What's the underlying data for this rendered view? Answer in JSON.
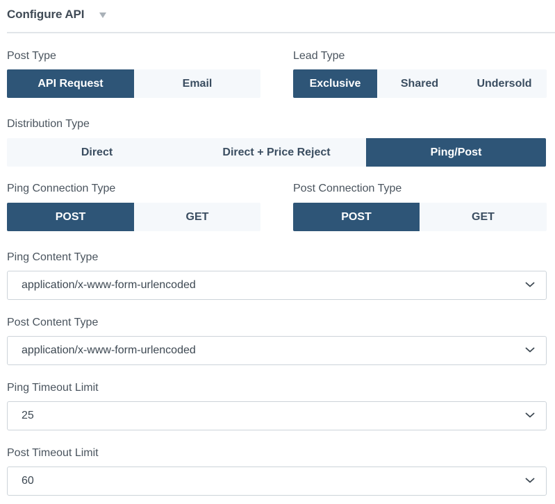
{
  "header": {
    "title": "Configure API"
  },
  "post_type": {
    "label": "Post Type",
    "options": [
      "API Request",
      "Email"
    ],
    "selected": "API Request"
  },
  "lead_type": {
    "label": "Lead Type",
    "options": [
      "Exclusive",
      "Shared",
      "Undersold"
    ],
    "selected": "Exclusive"
  },
  "distribution_type": {
    "label": "Distribution Type",
    "options": [
      "Direct",
      "Direct + Price Reject",
      "Ping/Post"
    ],
    "selected": "Ping/Post"
  },
  "ping_connection_type": {
    "label": "Ping Connection Type",
    "options": [
      "POST",
      "GET"
    ],
    "selected": "POST"
  },
  "post_connection_type": {
    "label": "Post Connection Type",
    "options": [
      "POST",
      "GET"
    ],
    "selected": "POST"
  },
  "ping_content_type": {
    "label": "Ping Content Type",
    "value": "application/x-www-form-urlencoded"
  },
  "post_content_type": {
    "label": "Post Content Type",
    "value": "application/x-www-form-urlencoded"
  },
  "ping_timeout_limit": {
    "label": "Ping Timeout Limit",
    "value": "25"
  },
  "post_timeout_limit": {
    "label": "Post Timeout Limit",
    "value": "60"
  },
  "colors": {
    "active": "#2e5577",
    "inactive_bg": "#f5f8fb",
    "text": "#3a4d60"
  }
}
